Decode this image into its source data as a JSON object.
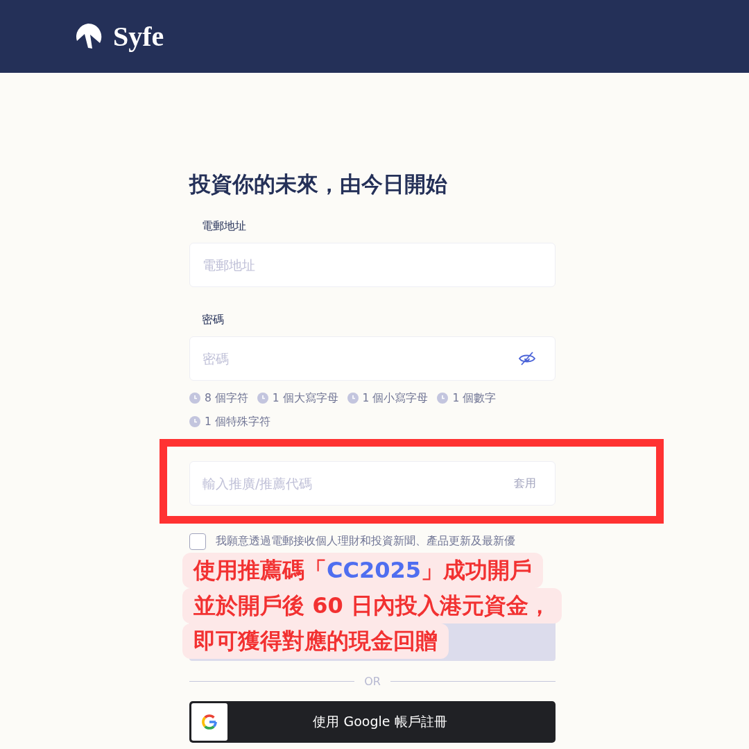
{
  "header": {
    "logo_text": "Syfe"
  },
  "title": "投資你的未來，由今日開始",
  "email": {
    "label": "電郵地址",
    "placeholder": "電郵地址"
  },
  "password": {
    "label": "密碼",
    "placeholder": "密碼"
  },
  "password_rules": [
    {
      "text": "8 個字符",
      "met": false
    },
    {
      "text": "1 個大寫字母",
      "met": false
    },
    {
      "text": "1 個小寫字母",
      "met": false
    },
    {
      "text": "1 個數字",
      "met": false
    },
    {
      "text": "1 個特殊字符",
      "met": false
    }
  ],
  "referral": {
    "placeholder": "輸入推廣/推薦代碼",
    "apply": "套用",
    "highlighted": true
  },
  "consent": {
    "text": "我願意透過電郵接收個人理財和投資新聞、產品更新及最新優",
    "checked": false
  },
  "divider_text": "OR",
  "google_button": "使用 Google 帳戶註冊",
  "callout": {
    "lines": [
      [
        {
          "kind": "plain",
          "text": "使用推薦碼「"
        },
        {
          "kind": "code",
          "text": "CC2025"
        },
        {
          "kind": "plain",
          "text": "」成功開戶"
        }
      ],
      [
        {
          "kind": "plain",
          "text": "並於開戶後 60 日內投入港元資金，"
        }
      ],
      [
        {
          "kind": "plain",
          "text": "即可獲得對應的現金回贈"
        }
      ]
    ]
  }
}
